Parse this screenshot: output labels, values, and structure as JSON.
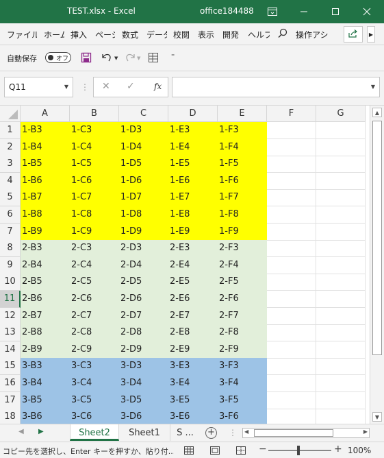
{
  "window": {
    "title": "TEST.xlsx  -  Excel",
    "user": "office184488"
  },
  "ribbon": {
    "tabs": [
      "ファイル",
      "ホーム",
      "挿入",
      "ページ",
      "数式",
      "データ",
      "校閲",
      "表示",
      "開発",
      "ヘルプ"
    ],
    "tell_me": "操作アシ"
  },
  "qat": {
    "autosave_label": "自動保存",
    "autosave_state": "オフ"
  },
  "formula_bar": {
    "name_box": "Q11",
    "formula": ""
  },
  "grid": {
    "columns": [
      "A",
      "B",
      "C",
      "D",
      "E",
      "F",
      "G"
    ],
    "selected_row": 11,
    "rows": [
      {
        "num": "1",
        "cells": [
          "1-B3",
          "1-C3",
          "1-D3",
          "1-E3",
          "1-F3"
        ],
        "fill": "#ffff00"
      },
      {
        "num": "2",
        "cells": [
          "1-B4",
          "1-C4",
          "1-D4",
          "1-E4",
          "1-F4"
        ],
        "fill": "#ffff00"
      },
      {
        "num": "3",
        "cells": [
          "1-B5",
          "1-C5",
          "1-D5",
          "1-E5",
          "1-F5"
        ],
        "fill": "#ffff00"
      },
      {
        "num": "4",
        "cells": [
          "1-B6",
          "1-C6",
          "1-D6",
          "1-E6",
          "1-F6"
        ],
        "fill": "#ffff00"
      },
      {
        "num": "5",
        "cells": [
          "1-B7",
          "1-C7",
          "1-D7",
          "1-E7",
          "1-F7"
        ],
        "fill": "#ffff00"
      },
      {
        "num": "6",
        "cells": [
          "1-B8",
          "1-C8",
          "1-D8",
          "1-E8",
          "1-F8"
        ],
        "fill": "#ffff00"
      },
      {
        "num": "7",
        "cells": [
          "1-B9",
          "1-C9",
          "1-D9",
          "1-E9",
          "1-F9"
        ],
        "fill": "#ffff00"
      },
      {
        "num": "8",
        "cells": [
          "2-B3",
          "2-C3",
          "2-D3",
          "2-E3",
          "2-F3"
        ],
        "fill": "#e2efda"
      },
      {
        "num": "9",
        "cells": [
          "2-B4",
          "2-C4",
          "2-D4",
          "2-E4",
          "2-F4"
        ],
        "fill": "#e2efda"
      },
      {
        "num": "10",
        "cells": [
          "2-B5",
          "2-C5",
          "2-D5",
          "2-E5",
          "2-F5"
        ],
        "fill": "#e2efda"
      },
      {
        "num": "11",
        "cells": [
          "2-B6",
          "2-C6",
          "2-D6",
          "2-E6",
          "2-F6"
        ],
        "fill": "#e2efda"
      },
      {
        "num": "12",
        "cells": [
          "2-B7",
          "2-C7",
          "2-D7",
          "2-E7",
          "2-F7"
        ],
        "fill": "#e2efda"
      },
      {
        "num": "13",
        "cells": [
          "2-B8",
          "2-C8",
          "2-D8",
          "2-E8",
          "2-F8"
        ],
        "fill": "#e2efda"
      },
      {
        "num": "14",
        "cells": [
          "2-B9",
          "2-C9",
          "2-D9",
          "2-E9",
          "2-F9"
        ],
        "fill": "#e2efda"
      },
      {
        "num": "15",
        "cells": [
          "3-B3",
          "3-C3",
          "3-D3",
          "3-E3",
          "3-F3"
        ],
        "fill": "#9dc3e6"
      },
      {
        "num": "16",
        "cells": [
          "3-B4",
          "3-C4",
          "3-D4",
          "3-E4",
          "3-F4"
        ],
        "fill": "#9dc3e6"
      },
      {
        "num": "17",
        "cells": [
          "3-B5",
          "3-C5",
          "3-D5",
          "3-E5",
          "3-F5"
        ],
        "fill": "#9dc3e6"
      },
      {
        "num": "18",
        "cells": [
          "3-B6",
          "3-C6",
          "3-D6",
          "3-E6",
          "3-F6"
        ],
        "fill": "#9dc3e6"
      }
    ]
  },
  "sheets": {
    "tabs": [
      "Sheet2",
      "Sheet1",
      "S ..."
    ],
    "active": "Sheet2"
  },
  "status": {
    "message": "コピー先を選択し、Enter キーを押すか、貼り付...",
    "zoom": "100%"
  },
  "colors": {
    "excel_green": "#217346",
    "yellow_fill": "#ffff00",
    "green_fill": "#e2efda",
    "blue_fill": "#9dc3e6"
  }
}
